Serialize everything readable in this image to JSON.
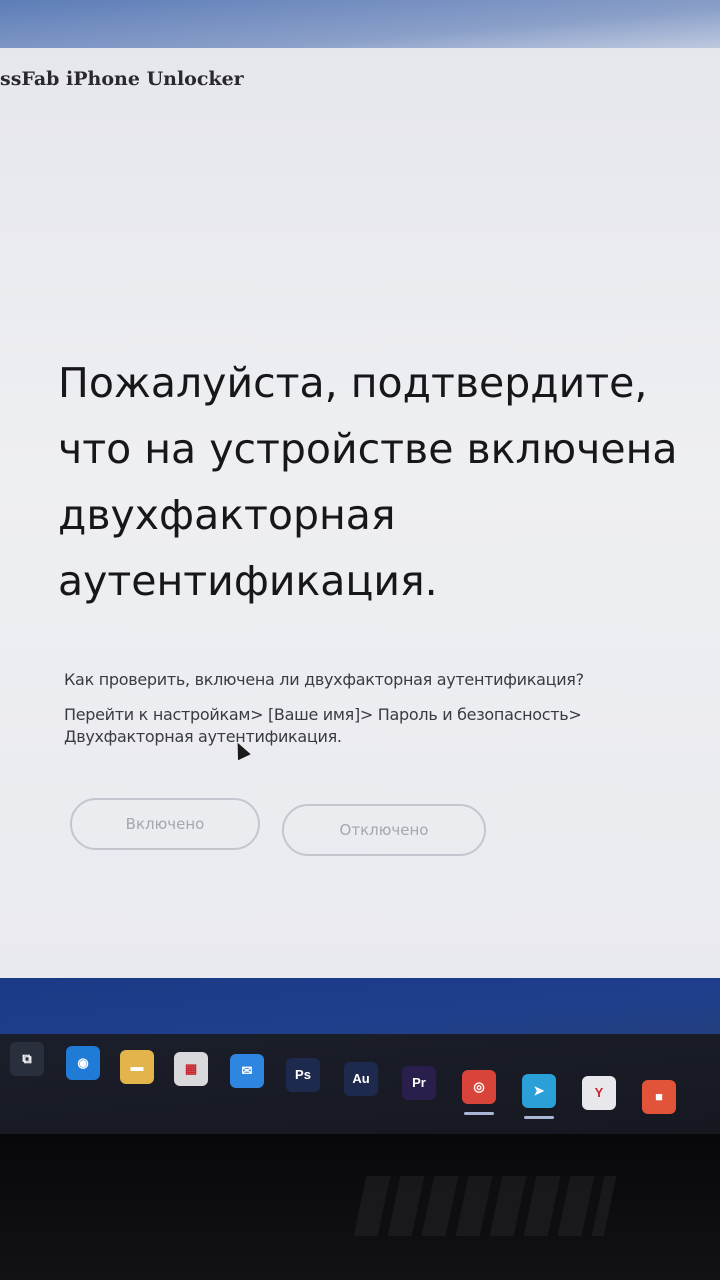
{
  "app": {
    "title": "ssFab iPhone Unlocker"
  },
  "main": {
    "headline": "Пожалуйста, подтвердите, что на устройстве включена двухфакторная аутентификация.",
    "question": "Как проверить, включена ли двухфакторная аутентификация?",
    "instructions": "Перейти к настройкам> [Ваше имя]> Пароль и безопасность> Двухфакторная аутентификация.",
    "buttons": {
      "enabled": "Включено",
      "disabled": "Отключено"
    }
  },
  "taskbar": {
    "icons": [
      {
        "name": "task-view-icon",
        "glyph": "⧉",
        "color": "#2a2f3d"
      },
      {
        "name": "edge-icon",
        "glyph": "◉",
        "color": "#1f7bd6"
      },
      {
        "name": "folder-icon",
        "glyph": "▬",
        "color": "#e3b44c"
      },
      {
        "name": "calculator-icon",
        "glyph": "▦",
        "color": "#d9d9dc"
      },
      {
        "name": "mail-icon",
        "glyph": "✉",
        "color": "#2f86e0"
      },
      {
        "name": "photoshop-icon",
        "glyph": "Ps",
        "color": "#1e2a4d"
      },
      {
        "name": "audition-icon",
        "glyph": "Au",
        "color": "#1e2a4d"
      },
      {
        "name": "premiere-icon",
        "glyph": "Pr",
        "color": "#2a1e4d"
      },
      {
        "name": "chrome-icon",
        "glyph": "◎",
        "color": "#d8443a"
      },
      {
        "name": "telegram-icon",
        "glyph": "➤",
        "color": "#2a9fd8"
      },
      {
        "name": "yandex-browser-icon",
        "glyph": "Y",
        "color": "#e8e8ec"
      },
      {
        "name": "media-player-icon",
        "glyph": "■",
        "color": "#e2543a"
      }
    ]
  }
}
